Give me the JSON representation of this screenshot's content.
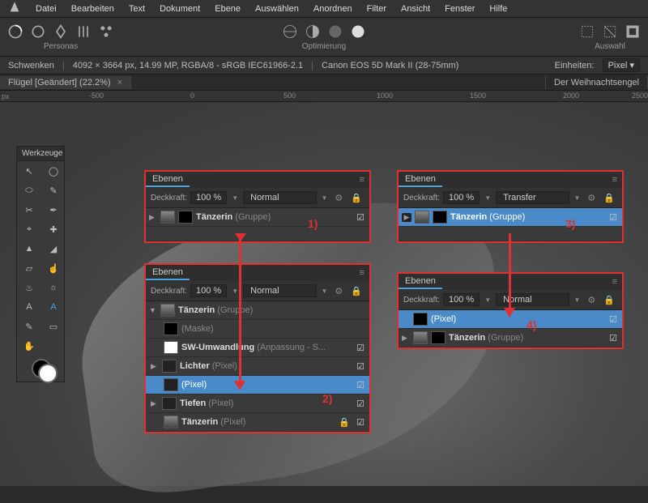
{
  "menu": [
    "Datei",
    "Bearbeiten",
    "Text",
    "Dokument",
    "Ebene",
    "Auswählen",
    "Anordnen",
    "Filter",
    "Ansicht",
    "Fenster",
    "Hilfe"
  ],
  "toolbar": {
    "personas_label": "Personas",
    "optimierung_label": "Optimierung",
    "auswahl_label": "Auswahl"
  },
  "infobar": {
    "tool": "Schwenken",
    "dims": "4092 × 3664 px, 14.99 MP, RGBA/8 - sRGB IEC61966-2.1",
    "camera": "Canon EOS 5D Mark II (28-75mm)",
    "units_label": "Einheiten:",
    "units_value": "Pixel"
  },
  "tabs": {
    "active": "Flügel [Geändert] (22.2%)",
    "other": "Der Weihnachtsengel"
  },
  "ruler": {
    "unit": "px",
    "marks": [
      "-500",
      "0",
      "500",
      "1000",
      "1500",
      "2000",
      "2500"
    ]
  },
  "tools_panel": {
    "title": "Werkzeuge"
  },
  "layers_common": {
    "tab_label": "Ebenen",
    "opacity_label": "Deckkraft:",
    "opacity_value": "100 %",
    "blend_normal": "Normal",
    "blend_transfer": "Transfer"
  },
  "panel1": {
    "layers": [
      {
        "name": "Tänzerin",
        "type": "(Gruppe)",
        "checked": true,
        "thumbs": 2
      }
    ],
    "annot": "1)"
  },
  "panel2": {
    "layers": [
      {
        "name": "Tänzerin",
        "type": "(Gruppe)",
        "arrow": "▼",
        "thumbs": 1
      },
      {
        "name": "",
        "type": "(Maske)",
        "child": true,
        "thumbs": 1,
        "mask": true
      },
      {
        "name": "SW-Umwandlung",
        "type": "(Anpassung - S...",
        "child": true,
        "thumbs": 1,
        "checked": true
      },
      {
        "name": "Lichter",
        "type": "(Pixel)",
        "child": true,
        "thumbs": 1,
        "arrow": "▶",
        "checked": true
      },
      {
        "name": "",
        "type": "(Pixel)",
        "child": true,
        "thumbs": 1,
        "selected": true,
        "checked": true
      },
      {
        "name": "Tiefen",
        "type": "(Pixel)",
        "child": true,
        "thumbs": 1,
        "arrow": "▶",
        "checked": true
      },
      {
        "name": "Tänzerin",
        "type": "(Pixel)",
        "child": true,
        "thumbs": 1,
        "locked": true,
        "checked": true
      }
    ],
    "annot": "2)"
  },
  "panel3": {
    "layers": [
      {
        "name": "Tänzerin",
        "type": "(Gruppe)",
        "selected": true,
        "checked": true,
        "thumbs": 2,
        "play": true
      }
    ],
    "annot": "3)"
  },
  "panel4": {
    "layers": [
      {
        "name": "",
        "type": "(Pixel)",
        "selected": true,
        "checked": true,
        "thumbs": 1
      },
      {
        "name": "Tänzerin",
        "type": "(Gruppe)",
        "checked": true,
        "thumbs": 2,
        "arrow": "▶"
      }
    ],
    "annot": "4)"
  }
}
